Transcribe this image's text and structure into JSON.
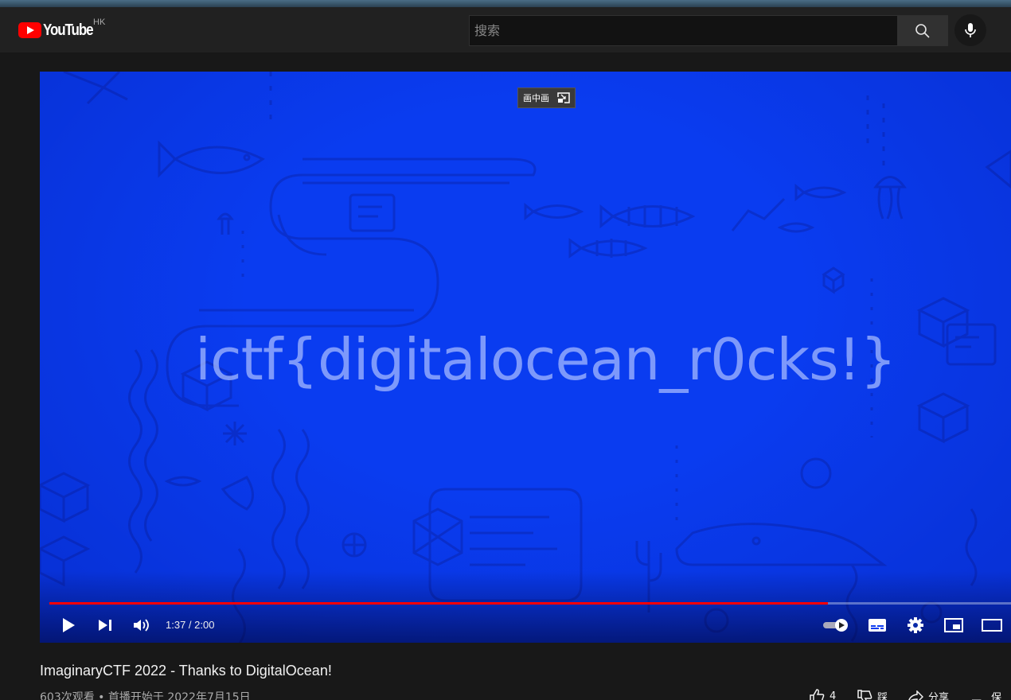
{
  "header": {
    "logo_text": "YouTube",
    "country_code": "HK",
    "search_placeholder": "搜索"
  },
  "player": {
    "pip_tooltip": "画中画",
    "flag_text": "ictf{digitalocean_r0cks!}",
    "time_display": "1:37 / 2:00",
    "progress_fraction": 0.81,
    "accent_color": "#ff0000",
    "background_color": "#0a3cf0"
  },
  "video": {
    "title": "ImaginaryCTF 2022 - Thanks to DigitalOcean!",
    "meta": "603次观看 • 首播开始于 2022年7月15日",
    "like_count": "4",
    "dislike_label": "踩",
    "share_label": "分享",
    "save_label": "保存"
  }
}
